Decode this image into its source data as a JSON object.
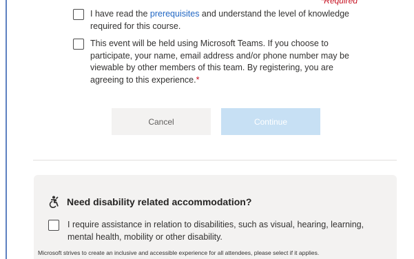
{
  "form": {
    "required_note": "*Required",
    "prereq": {
      "text_before": "I have read the ",
      "link": "prerequisites",
      "text_after_line1": " and understand the level of knowledge",
      "text_line2": "required for this course."
    },
    "teams_notice": {
      "line1": "This event will be held using Microsoft Teams. If you choose to",
      "line2": "participate, your name, email address and/or phone number may be",
      "line3": "viewable by other members of this team. By registering, you are",
      "line4": "agreeing to this experience.",
      "required_star": "*"
    },
    "buttons": {
      "cancel": "Cancel",
      "continue": "Continue"
    }
  },
  "accommodation": {
    "title": "Need disability related accommodation?",
    "checkbox_line1": "I require assistance in relation to disabilities, such as visual, hearing, learning,",
    "checkbox_line2": "mental health, mobility or other disability.",
    "note": "Microsoft strives to create an inclusive and accessible experience for all attendees, please select if it applies.",
    "icon": "accessibility-icon"
  },
  "colors": {
    "link": "#2167c4",
    "required": "#c50f1f",
    "continue_disabled": "#c7e0f4",
    "cancel_bg": "#f3f2f1",
    "panel_bg": "#f3f2f1"
  }
}
